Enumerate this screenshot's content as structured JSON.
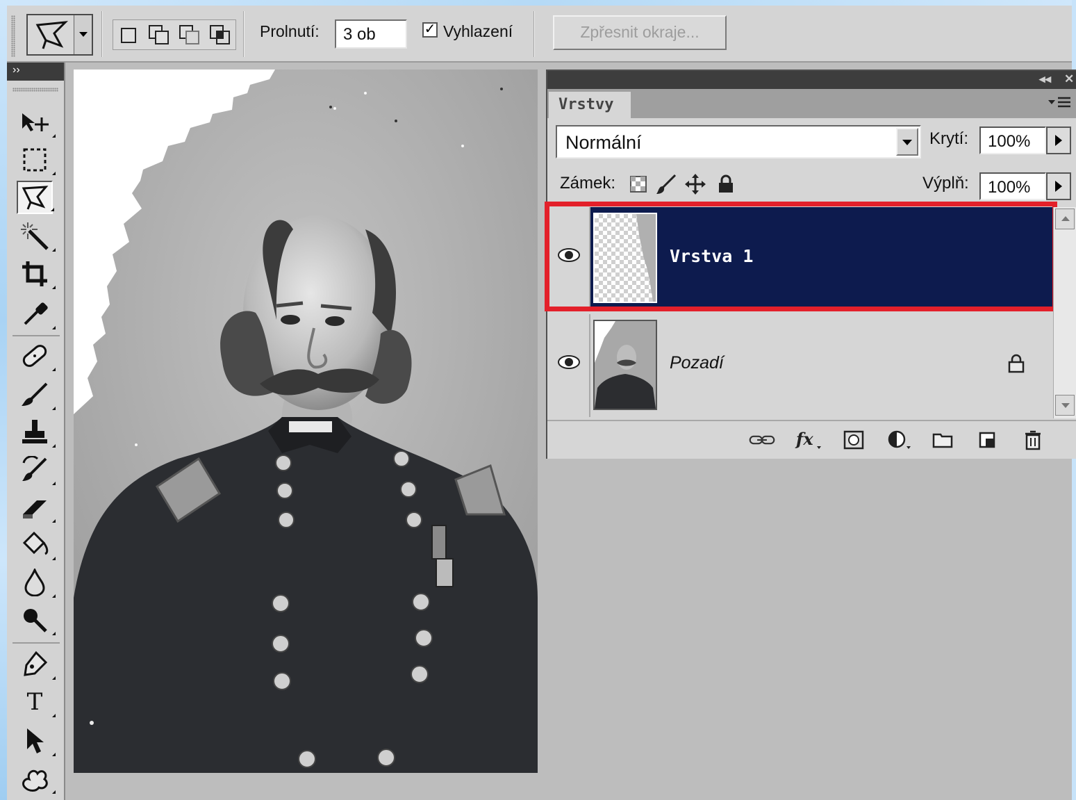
{
  "options_bar": {
    "feather_label": "Prolnutí:",
    "feather_value": "3 ob",
    "antialias_label": "Vyhlazení",
    "antialias_checked": "✓",
    "refine_edge_label": "Zpřesnit okraje..."
  },
  "toolbox": {
    "header": "››",
    "type_tool_glyph": "T"
  },
  "layers_panel": {
    "collapse_glyph": "◂◂",
    "close_glyph": "✕",
    "tab_label": "Vrstvy",
    "blend_mode": "Normální",
    "opacity_label": "Krytí:",
    "opacity_value": "100%",
    "lock_label": "Zámek:",
    "fill_label": "Výplň:",
    "fill_value": "100%",
    "layers": [
      {
        "name": "Vrstva 1",
        "selected": true
      },
      {
        "name": "Pozadí",
        "selected": false,
        "locked": true
      }
    ]
  },
  "colors": {
    "selected_layer": "#0d1b4e",
    "highlight_box": "#e3202a",
    "frame": "#b5daf6"
  }
}
